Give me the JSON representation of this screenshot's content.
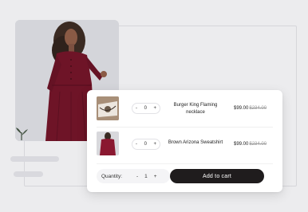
{
  "cart": {
    "items": [
      {
        "name": "Burger King Flaming necklace",
        "quantity": "0",
        "price": "$99.00",
        "old_price": "$234.00",
        "minus": "-",
        "plus": "+"
      },
      {
        "name": "Brown Arizona Sweatshirt",
        "quantity": "0",
        "price": "$99.00",
        "old_price": "$234.00",
        "minus": "-",
        "plus": "+"
      }
    ],
    "quantity_label": "Quantity:",
    "quantity_value": "1",
    "minus": "-",
    "plus": "+",
    "add_to_cart": "Add to cart"
  },
  "colors": {
    "button_bg": "#1f1c1d",
    "dress": "#6e1427"
  }
}
